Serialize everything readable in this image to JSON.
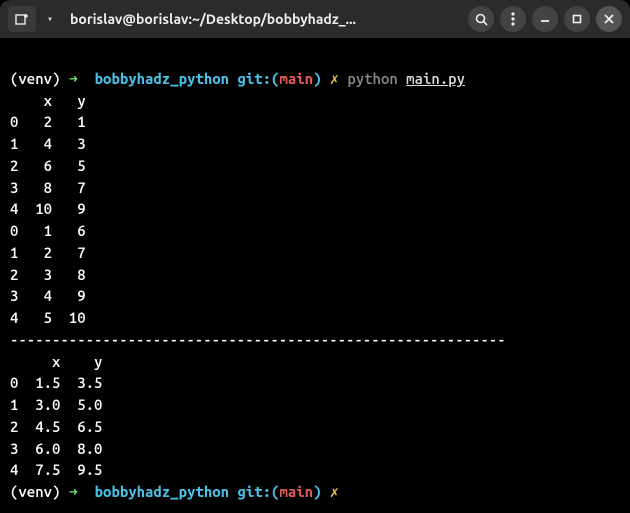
{
  "titlebar": {
    "title": "borislav@borislav:~/Desktop/bobbyhadz_..."
  },
  "prompt": {
    "venv": "(venv)",
    "arrow": "➜",
    "dir": "bobbyhadz_python",
    "git_label": "git:(",
    "branch": "main",
    "git_close": ")",
    "dirty": "✗",
    "cmd_py": "python",
    "cmd_file": "main.py"
  },
  "output1": {
    "header": "    x   y",
    "rows": [
      "0   2   1",
      "1   4   3",
      "2   6   5",
      "3   8   7",
      "4  10   9",
      "0   1   6",
      "1   2   7",
      "2   3   8",
      "3   4   9",
      "4   5  10"
    ]
  },
  "separator": "-----------------------------------------------------------",
  "output2": {
    "header": "     x    y",
    "rows": [
      "0  1.5  3.5",
      "1  3.0  5.0",
      "2  4.5  6.5",
      "3  6.0  8.0",
      "4  7.5  9.5"
    ]
  }
}
